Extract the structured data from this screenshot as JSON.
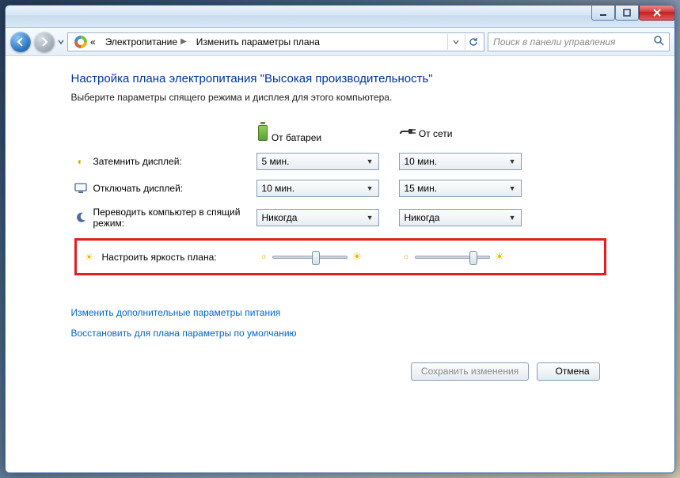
{
  "breadcrumb": {
    "seg1": "Электропитание",
    "seg2": "Изменить параметры плана",
    "back_prefix": "«"
  },
  "search": {
    "placeholder": "Поиск в панели управления"
  },
  "page": {
    "title": "Настройка плана электропитания \"Высокая производительность\"",
    "subtitle": "Выберите параметры спящего режима и дисплея для этого компьютера."
  },
  "columns": {
    "battery": "От батареи",
    "ac": "От сети"
  },
  "rows": {
    "dim": {
      "label": "Затемнить дисплей:",
      "battery_value": "5 мин.",
      "ac_value": "10 мин."
    },
    "turnoff": {
      "label": "Отключать дисплей:",
      "battery_value": "10 мин.",
      "ac_value": "15 мин."
    },
    "sleep": {
      "label": "Переводить компьютер в спящий режим:",
      "battery_value": "Никогда",
      "ac_value": "Никогда"
    },
    "brightness": {
      "label": "Настроить яркость плана:",
      "battery_pct": 58,
      "ac_pct": 80
    }
  },
  "links": {
    "advanced": "Изменить дополнительные параметры питания",
    "restore": "Восстановить для плана параметры по умолчанию"
  },
  "buttons": {
    "save": "Сохранить изменения",
    "cancel": "Отмена"
  }
}
